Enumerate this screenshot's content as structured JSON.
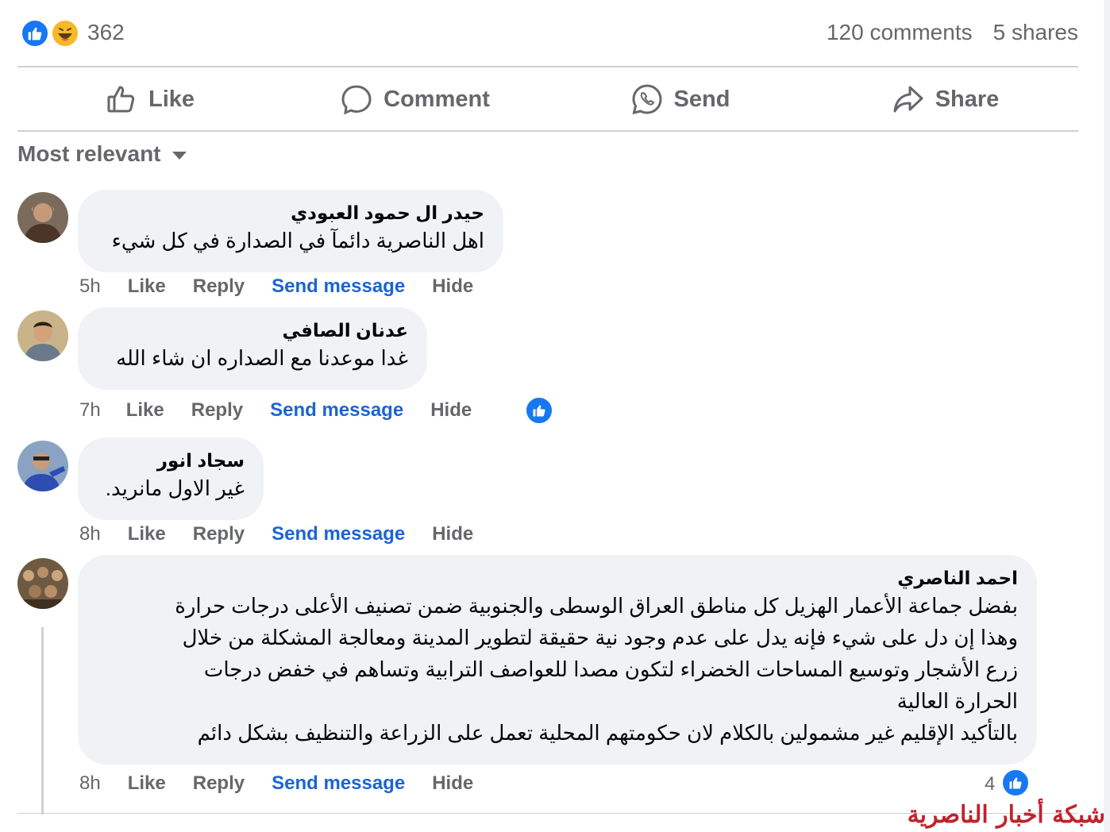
{
  "stats": {
    "reaction_count": "362",
    "comments": "120 comments",
    "shares": "5 shares"
  },
  "actions": {
    "like": "Like",
    "comment": "Comment",
    "send": "Send",
    "share": "Share"
  },
  "filter": {
    "label": "Most relevant"
  },
  "comments": [
    {
      "author": "حيدر ال حمود العبودي",
      "text": "اهل الناصرية دائمآ في الصدارة في كل شيء",
      "time": "5h",
      "like": "Like",
      "reply": "Reply",
      "send_message": "Send message",
      "hide": "Hide"
    },
    {
      "author": "عدنان الصافي",
      "text": "غدا موعدنا مع الصداره ان شاء الله",
      "time": "7h",
      "like": "Like",
      "reply": "Reply",
      "send_message": "Send message",
      "hide": "Hide"
    },
    {
      "author": "سجاد انور",
      "text": "غير الاول مانريد.",
      "time": "8h",
      "like": "Like",
      "reply": "Reply",
      "send_message": "Send message",
      "hide": "Hide"
    },
    {
      "author": "احمد الناصري",
      "text": "بفضل جماعة الأعمار الهزيل كل مناطق العراق الوسطى والجنوبية ضمن تصنيف الأعلى درجات حرارة\nوهذا إن دل على شيء فإنه يدل على عدم وجود نية حقيقة لتطوير المدينة ومعالجة المشكلة من خلال\nزرع الأشجار وتوسيع المساحات الخضراء لتكون مصدا للعواصف الترابية وتساهم في خفض درجات\nالحرارة العالية\nبالتأكيد الإقليم غير مشمولين بالكلام لان حكومتهم المحلية تعمل على الزراعة والتنظيف بشكل دائم",
      "time": "8h",
      "like": "Like",
      "reply": "Reply",
      "send_message": "Send message",
      "hide": "Hide",
      "reaction_count": "4"
    }
  ],
  "watermark": "شبكة أخبار الناصرية",
  "colors": {
    "accent_blue": "#1877f2",
    "link_blue": "#1b64d4",
    "muted": "#65676b",
    "bubble": "#f0f2f5",
    "watermark_red": "#c0232c"
  },
  "icons": [
    "like-reaction-icon",
    "haha-reaction-icon",
    "thumbs-up-icon",
    "comment-icon",
    "whatsapp-icon",
    "share-icon",
    "chevron-down-icon"
  ]
}
